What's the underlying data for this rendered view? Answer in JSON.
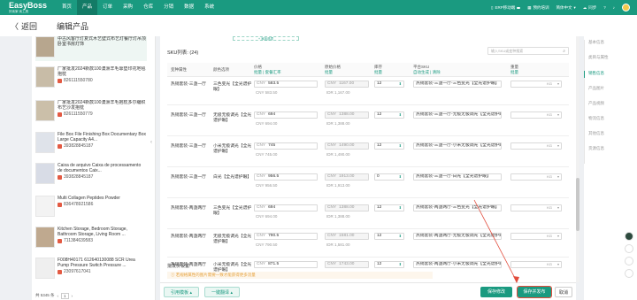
{
  "header": {
    "brand": "EasyBoss",
    "tagline": "好卖家·卖工具",
    "nav": [
      "首页",
      "产品",
      "订单",
      "采购",
      "仓库",
      "分销",
      "数据",
      "系统"
    ],
    "active_nav": "产品",
    "right": {
      "erp": "ERP移动端",
      "erp_badge": "",
      "schedule": "预约培训",
      "lang": "简体中文",
      "sync": "同步"
    }
  },
  "subbar": {
    "back": "返回",
    "title": "编辑产品"
  },
  "products": [
    {
      "name": "中古风客厅灯复式木艺壁式布艺灯餐厅灯吊顶卧室书房灯饰",
      "sku": ""
    },
    {
      "name": "厂家批发2024新款100澳洲羊毛靠垫印花地毯抱枕",
      "sku": "826111550780"
    },
    {
      "name": "厂家批发2024新款100澳洲羊毛抱枕多尔编织布艺沙发抱枕",
      "sku": "826111550779"
    },
    {
      "name": "File Box File Finishing Box Documentary Box Large Capacity A4...",
      "sku": "393828845187"
    },
    {
      "name": "Caixa de arquivo Caixa de processamento de documentos Caix...",
      "sku": "393828845187"
    },
    {
      "name": "Multi Collagen Peptides Powder",
      "sku": "836478921586"
    },
    {
      "name": "Kitchen Storage, Bedroom Storage, Bathroom Storage, Living Room ...",
      "sku": "711384639583"
    },
    {
      "name": "F008H40171 612640130088 SCR Urea Pump Pressure Switch Pressure ...",
      "sku": "23097617041"
    }
  ],
  "left_footer": {
    "total": "共 5345 条",
    "page": "1"
  },
  "sku": {
    "add_label": "+ 添加选项",
    "count_label": "SKU列表: (24)",
    "search_placeholder": "输入SKU或变种搜索",
    "headers": {
      "variant": "变种属性",
      "option": "颜色选项",
      "price": "价格",
      "price_sub": "批量 | 套餐汇率",
      "original": "原始价格",
      "original_sub": "批量",
      "stock": "库存",
      "stock_sub": "批量",
      "platform_sku": "平台SKU",
      "platform_sku_sub": "自动生成 | 清除",
      "weight": "重量",
      "weight_sub": "批量"
    },
    "rows": [
      {
        "variant": "热销套装-三盏一厅",
        "option": "三色变光【全光谱护眼】",
        "price": "583.5",
        "price_sub": "CNY 583.50",
        "original": "1167.00",
        "original_sub": "IDR 1,167.00",
        "stock": "12",
        "platform_sku": "热销套装-三盏一厅-三色变光【全光谱护眼】",
        "weight": "",
        "unit": "KG"
      },
      {
        "variant": "热销套装-三盏一厅",
        "option": "无极无极调光【全光谱护眼】",
        "price": "694",
        "price_sub": "CNY 694.00",
        "original": "1388.00",
        "original_sub": "IDR 1,388.00",
        "stock": "12",
        "platform_sku": "热销套装-三盏一厅-无极无极调光【全光谱护眼】",
        "weight": "",
        "unit": "KG"
      },
      {
        "variant": "热销套装-三盏一厅",
        "option": "小米无极调光【全光谱护眼】",
        "price": "745",
        "price_sub": "CNY 745.00",
        "original": "1490.00",
        "original_sub": "IDR 1,490.00",
        "stock": "12",
        "platform_sku": "热销套装-三盏一厅-小米无极调光【全光谱护眼】",
        "weight": "",
        "unit": "KG"
      },
      {
        "variant": "热销套装-三盏一厅",
        "option": "白光【全光谱护眼】",
        "price": "956.5",
        "price_sub": "CNY 956.50",
        "original": "1913.00",
        "original_sub": "IDR 1,913.00",
        "stock": "0",
        "platform_sku": "热销套装-三盏一厅-白光【全光谱护眼】",
        "weight": "",
        "unit": "KG"
      },
      {
        "variant": "热销套装-两盏两厅",
        "option": "三色变光【全光谱护眼】",
        "price": "694",
        "price_sub": "CNY 694.00",
        "original": "1388.00",
        "original_sub": "IDR 1,388.00",
        "stock": "12",
        "platform_sku": "热销套装-两盏两厅-三色变光【全光谱护眼】",
        "weight": "",
        "unit": "KG"
      },
      {
        "variant": "热销套装-两盏两厅",
        "option": "无极无极调光【全光谱护眼】",
        "price": "790.5",
        "price_sub": "CNY 790.50",
        "original": "1581.00",
        "original_sub": "IDR 1,581.00",
        "stock": "12",
        "platform_sku": "热销套装-两盏两厅-无极无极调光【全光谱护眼】",
        "weight": "",
        "unit": "KG"
      },
      {
        "variant": "热销套装-两盏两厅",
        "option": "小米无极调光【全光谱护眼】",
        "price": "871.5",
        "price_sub": "",
        "original": "1743.00",
        "original_sub": "",
        "stock": "12",
        "platform_sku": "热销套装-两盏两厅-小米无极调光【全光谱护眼】",
        "weight": "",
        "unit": "KG"
      }
    ],
    "tail_label": "批发价设置:",
    "warning": "① 若规格属性的图片需要一致才能获得更多流量"
  },
  "footer": {
    "template": "引用模板",
    "translate": "一键翻译",
    "save": "保存修改",
    "save_publish": "保存并发布",
    "cancel": "取消"
  },
  "right_nav": [
    "基本信息",
    "类目与属性",
    "销售信息",
    "产品图片",
    "产品视频",
    "物流信息",
    "其他信息",
    "货源信息"
  ],
  "right_nav_active": "销售信息"
}
